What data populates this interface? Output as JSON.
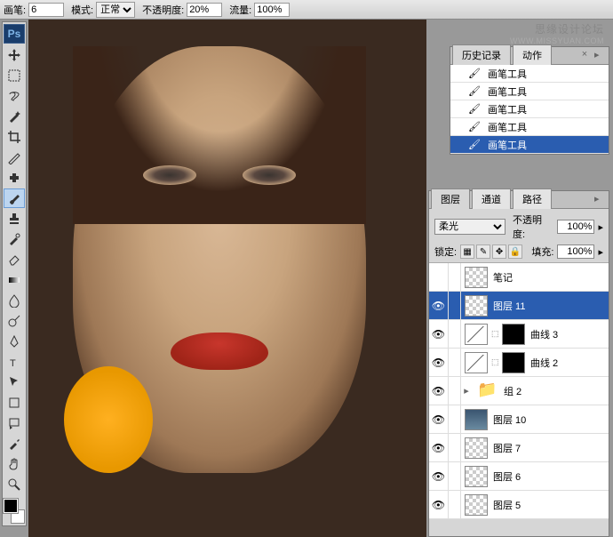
{
  "options_bar": {
    "brush_label": "画笔:",
    "brush_size": "6",
    "mode_label": "模式:",
    "mode_value": "正常",
    "opacity_label": "不透明度:",
    "opacity_value": "20%",
    "flow_label": "流量:",
    "flow_value": "100%"
  },
  "watermark": {
    "main": "思缘设计论坛",
    "sub": "WWW.MISSYUAN.COM"
  },
  "toolbox": {
    "logo": "Ps",
    "swatch_fg": "#000000",
    "swatch_bg": "#ffffff"
  },
  "history_panel": {
    "tabs": [
      "历史记录",
      "动作"
    ],
    "active_tab": 0,
    "items": [
      {
        "tool": "brush",
        "label": "画笔工具"
      },
      {
        "tool": "brush",
        "label": "画笔工具"
      },
      {
        "tool": "brush",
        "label": "画笔工具"
      },
      {
        "tool": "brush",
        "label": "画笔工具"
      },
      {
        "tool": "brush",
        "label": "画笔工具"
      }
    ],
    "active_index": 4
  },
  "layers_panel": {
    "tabs": [
      "图层",
      "通道",
      "路径"
    ],
    "active_tab": 0,
    "blend_mode": "柔光",
    "opacity_label": "不透明度:",
    "opacity_value": "100%",
    "lock_label": "锁定:",
    "fill_label": "填充:",
    "fill_value": "100%",
    "layers": [
      {
        "visible": false,
        "thumb": "checker",
        "name": "笔记"
      },
      {
        "visible": true,
        "thumb": "checker",
        "name": "图层 11",
        "active": true
      },
      {
        "visible": true,
        "thumb": "curves",
        "mask": "dark",
        "name": "曲线 3",
        "adj": true
      },
      {
        "visible": true,
        "thumb": "curves",
        "mask": "dark",
        "name": "曲线 2",
        "adj": true
      },
      {
        "visible": true,
        "thumb": "folder",
        "name": "组 2",
        "group": true
      },
      {
        "visible": true,
        "thumb": "img",
        "name": "图层 10"
      },
      {
        "visible": true,
        "thumb": "checker",
        "name": "图层 7"
      },
      {
        "visible": true,
        "thumb": "checker",
        "name": "图层 6"
      },
      {
        "visible": true,
        "thumb": "checker",
        "name": "图层 5"
      }
    ]
  }
}
